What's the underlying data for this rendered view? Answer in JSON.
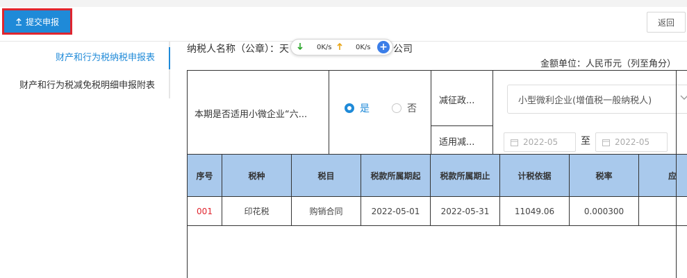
{
  "toolbar": {
    "submit_label": "提交申报",
    "back_label": "返回"
  },
  "sidebar": {
    "items": [
      {
        "label": "财产和行为税纳税申报表",
        "active": true
      },
      {
        "label": "财产和行为税减免税明细申报附表",
        "active": false
      }
    ]
  },
  "header": {
    "taxpayer_label": "纳税人名称（公章）：天",
    "taxpayer_suffix": "公司",
    "amount_unit": "金额单位：人民币元（列至角分）"
  },
  "speed_widget": {
    "download": "0K/s",
    "upload": "0K/s",
    "plus": "+"
  },
  "form": {
    "question": "本期是否适用小微企业“六...",
    "yes_label": "是",
    "no_label": "否",
    "selected": "是",
    "policy_label": "减征政...",
    "policy_value": "小型微利企业(增值税一般纳税人)",
    "apply_label": "适用减...",
    "date_from_placeholder": "2022-05",
    "date_to_placeholder": "2022-05",
    "to_label": "至"
  },
  "table": {
    "columns": [
      "序号",
      "税种",
      "税目",
      "税款所属期起",
      "税款所属期止",
      "计税依据",
      "税率",
      "应"
    ],
    "rows": [
      [
        "001",
        "印花税",
        "购销合同",
        "2022-05-01",
        "2022-05-31",
        "11049.06",
        "0.000300",
        ""
      ]
    ]
  },
  "colors": {
    "accent": "#1f8ad8",
    "highlight_border": "#e0252e",
    "table_header": "#a9c9ec"
  }
}
